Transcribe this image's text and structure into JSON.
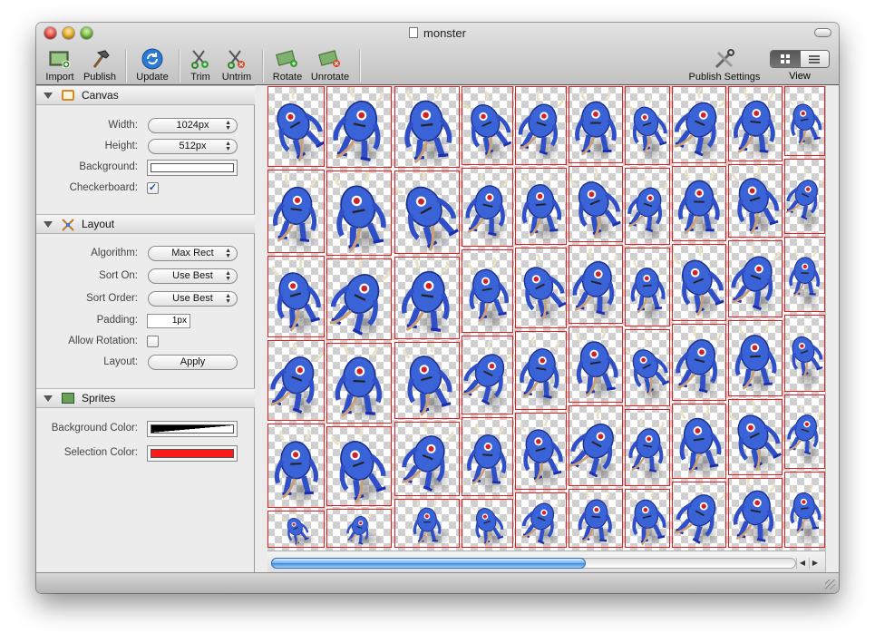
{
  "window": {
    "title": "monster"
  },
  "toolbar": {
    "import": "Import",
    "publish": "Publish",
    "update": "Update",
    "trim": "Trim",
    "untrim": "Untrim",
    "rotate": "Rotate",
    "unrotate": "Unrotate",
    "publish_settings": "Publish Settings",
    "view": "View"
  },
  "canvas_section": {
    "title": "Canvas",
    "width_label": "Width:",
    "width_value": "1024px",
    "height_label": "Height:",
    "height_value": "512px",
    "background_label": "Background:",
    "checkerboard_label": "Checkerboard:",
    "checkerboard_checked": true
  },
  "layout_section": {
    "title": "Layout",
    "algorithm_label": "Algorithm:",
    "algorithm_value": "Max Rect",
    "sort_on_label": "Sort On:",
    "sort_on_value": "Use Best",
    "sort_order_label": "Sort Order:",
    "sort_order_value": "Use Best",
    "padding_label": "Padding:",
    "padding_value": "1px",
    "allow_rotation_label": "Allow Rotation:",
    "allow_rotation_checked": false,
    "layout_label": "Layout:",
    "apply_label": "Apply"
  },
  "sprites_section": {
    "title": "Sprites",
    "background_color_label": "Background Color:",
    "selection_color_label": "Selection Color:",
    "selection_color": "#ff1a1a"
  },
  "colors": {
    "sprite_border": "#e02020",
    "monster_blue": "#3b63d8",
    "scroll_thumb": "#3a8ad9"
  },
  "canvas": {
    "sprite_count": 68,
    "scroll_fraction": 0.6
  }
}
